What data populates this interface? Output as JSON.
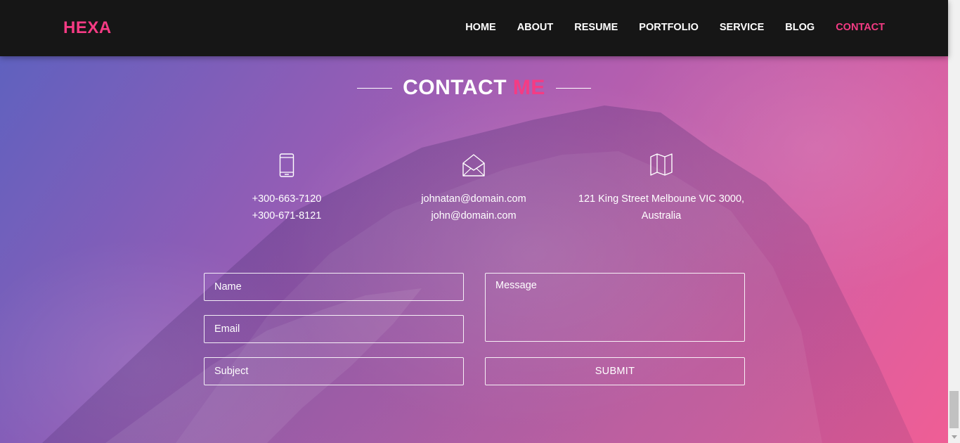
{
  "header": {
    "logo": "HEXA",
    "nav": [
      "HOME",
      "ABOUT",
      "RESUME",
      "PORTFOLIO",
      "SERVICE",
      "BLOG",
      "CONTACT"
    ],
    "active_nav": "CONTACT"
  },
  "section": {
    "title": "CONTACT",
    "title_accent": "ME"
  },
  "contact_info": {
    "phone": {
      "icon": "mobile-phone-icon",
      "line1": "+300-663-7120",
      "line2": "+300-671-8121"
    },
    "email": {
      "icon": "envelope-icon",
      "line1": "johnatan@domain.com",
      "line2": "john@domain.com"
    },
    "address": {
      "icon": "map-icon",
      "line1": "121 King Street Melboune VIC 3000,",
      "line2": "Australia"
    }
  },
  "form": {
    "name_placeholder": "Name",
    "email_placeholder": "Email",
    "subject_placeholder": "Subject",
    "message_placeholder": "Message",
    "submit_label": "SUBMIT"
  },
  "colors": {
    "accent": "#f53b84",
    "header_bg": "#161616",
    "gradient_start": "#5a62c0",
    "gradient_end": "#ef5e95"
  }
}
